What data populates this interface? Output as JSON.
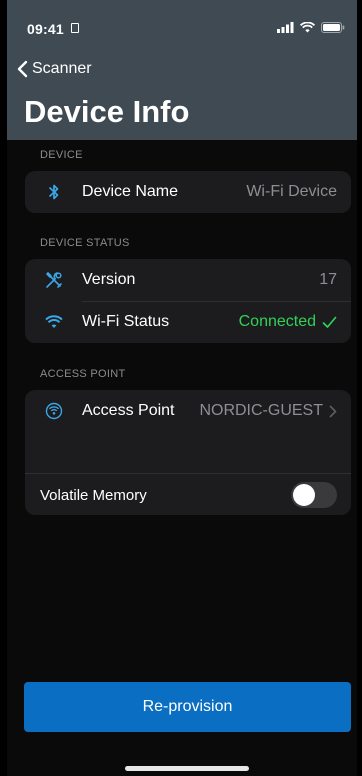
{
  "status": {
    "time": "09:41"
  },
  "nav": {
    "back_label": "Scanner",
    "title": "Device Info"
  },
  "device_section": {
    "header": "DEVICE",
    "name_label": "Device Name",
    "name_value": "Wi-Fi Device"
  },
  "status_section": {
    "header": "DEVICE STATUS",
    "version_label": "Version",
    "version_value": "17",
    "wifi_label": "Wi-Fi Status",
    "wifi_value": "Connected"
  },
  "ap_section": {
    "header": "ACCESS POINT",
    "ap_label": "Access Point",
    "ap_value": "NORDIC-GUEST",
    "volatile_label": "Volatile Memory",
    "volatile_on": false
  },
  "actions": {
    "reprovision_label": "Re-provision"
  },
  "colors": {
    "accent": "#0a6ec2",
    "icon": "#3aa6e6",
    "success": "#30d158",
    "header_bg": "#3f4a53"
  }
}
